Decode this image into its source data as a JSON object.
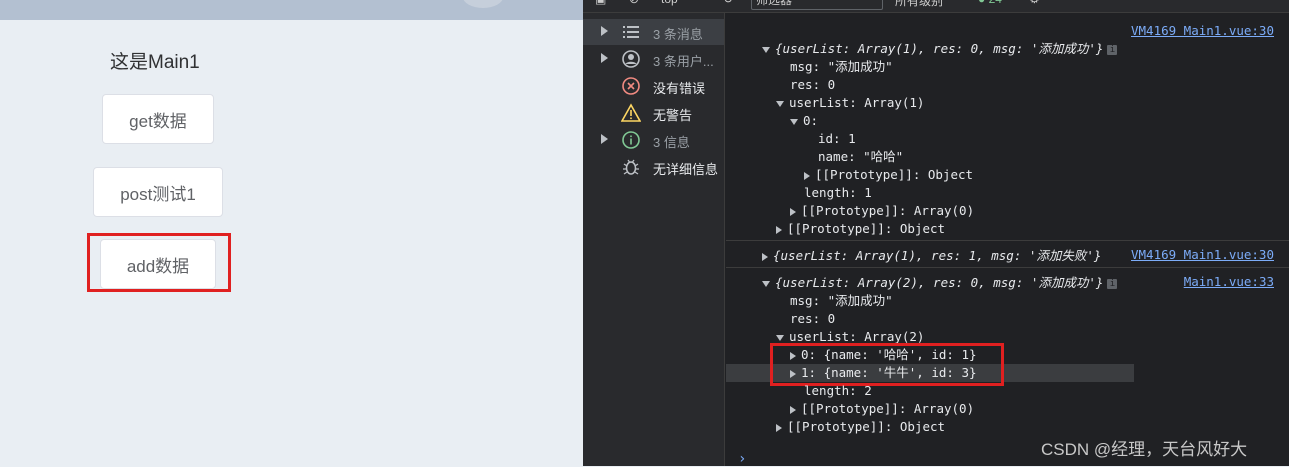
{
  "app": {
    "title": "这是Main1",
    "buttons": {
      "get": "get数据",
      "post": "post测试1",
      "add": "add数据"
    }
  },
  "devtools": {
    "toolbar": {
      "context": "top",
      "filter_placeholder": "筛选器",
      "levels": "所有级别",
      "issues_count": "24"
    },
    "sidebar": [
      {
        "label": "3 条消息",
        "icon": "list-icon",
        "expandable": true
      },
      {
        "label": "3 条用户...",
        "icon": "user-icon",
        "expandable": true
      },
      {
        "label": "没有错误",
        "icon": "error-icon",
        "expandable": false
      },
      {
        "label": "无警告",
        "icon": "warning-icon",
        "expandable": false
      },
      {
        "label": "3 信息",
        "icon": "info-icon",
        "expandable": true
      },
      {
        "label": "无详细信息",
        "icon": "bug-icon",
        "expandable": false
      }
    ],
    "console": {
      "log1": {
        "summary": "{userList: Array(1), res: 0, msg: '添加成功'}",
        "source": "VM4169 Main1.vue:30",
        "lines": [
          "msg: \"添加成功\"",
          "res: 0",
          "userList: Array(1)",
          "0:",
          "id: 1",
          "name: \"哈哈\"",
          "[[Prototype]]: Object",
          "length: 1",
          "[[Prototype]]: Array(0)",
          "[[Prototype]]: Object"
        ]
      },
      "log2": {
        "summary": "{userList: Array(1), res: 1, msg: '添加失败'}",
        "source": "VM4169 Main1.vue:30"
      },
      "log3": {
        "summary": "{userList: Array(2), res: 0, msg: '添加成功'}",
        "source": "Main1.vue:33",
        "lines": [
          "msg: \"添加成功\"",
          "res: 0",
          "userList: Array(2)",
          "0: {name: '哈哈', id: 1}",
          "1: {name: '牛牛', id: 3}",
          "length: 2",
          "[[Prototype]]: Array(0)",
          "[[Prototype]]: Object"
        ]
      }
    }
  },
  "watermark": "CSDN @经理，天台风好大",
  "colors": {
    "highlight": "#e02020",
    "link": "#7cacf8",
    "string": "#5cd5fb",
    "number": "#9980ff"
  }
}
